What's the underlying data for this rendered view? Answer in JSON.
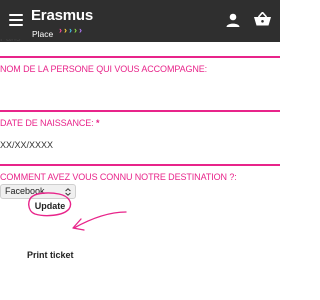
{
  "header": {
    "logo_name": "Erasmus",
    "logo_place": "Place",
    "logo_chevron_colors": [
      "#ff4e9b",
      "#ffd23f",
      "#46c6f0",
      "#8ee04a",
      "#b57cff"
    ],
    "menu_icon": "hamburger-menu-icon",
    "user_icon": "user-icon",
    "cart_icon": "shopping-cart-icon",
    "background": "#2f2f2f"
  },
  "form": {
    "accent_color": "#e8248a",
    "companion_label": "NOM DE LA PERSONE QUI VOUS ACCOMPAGNE:",
    "birthdate_label": "DATE DE NAISSANCE:",
    "required_mark": "*",
    "birthdate_value": "XX/XX/XXXX",
    "source_label": "COMMENT AVEZ VOUS CONNU NOTRE DESTINATION ?:",
    "source_select_value": "Facebook"
  },
  "actions": {
    "update_label": "Update",
    "print_ticket_label": "Print ticket",
    "annotation_color": "#e8248a"
  }
}
